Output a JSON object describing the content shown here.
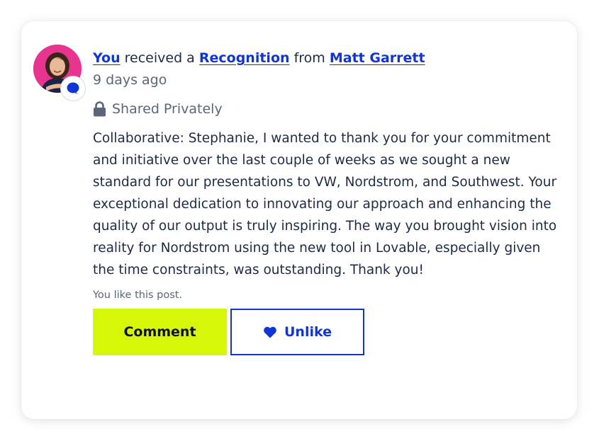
{
  "post": {
    "headline": {
      "actor": "You",
      "verb": "received a",
      "object": "Recognition",
      "preposition": "from",
      "sender": "Matt Garrett"
    },
    "timestamp": "9 days ago",
    "privacy": {
      "icon": "lock-icon",
      "label": "Shared Privately"
    },
    "message": "Collaborative: Stephanie, I wanted to thank you for your commitment and initiative over the last couple of weeks as we sought a new standard for our presentations to VW, Nordstrom, and Southwest. Your exceptional dedication to innovating our approach and enhancing the quality of our output is truly inspiring. The way you brought vision into reality for Nordstrom using the new tool in Lovable, especially given the time constraints, was outstanding. Thank you!",
    "like_note": "You like this post.",
    "avatar": {
      "badge_icon": "chat-bubble-icon"
    }
  },
  "actions": {
    "comment_label": "Comment",
    "unlike_label": "Unlike",
    "unlike_icon": "heart-icon"
  },
  "colors": {
    "link": "#1035d6",
    "comment_button": "#d7f70a",
    "avatar_background": "#e8338f",
    "body_text": "#1f2a44",
    "muted_text": "#5b6676"
  }
}
